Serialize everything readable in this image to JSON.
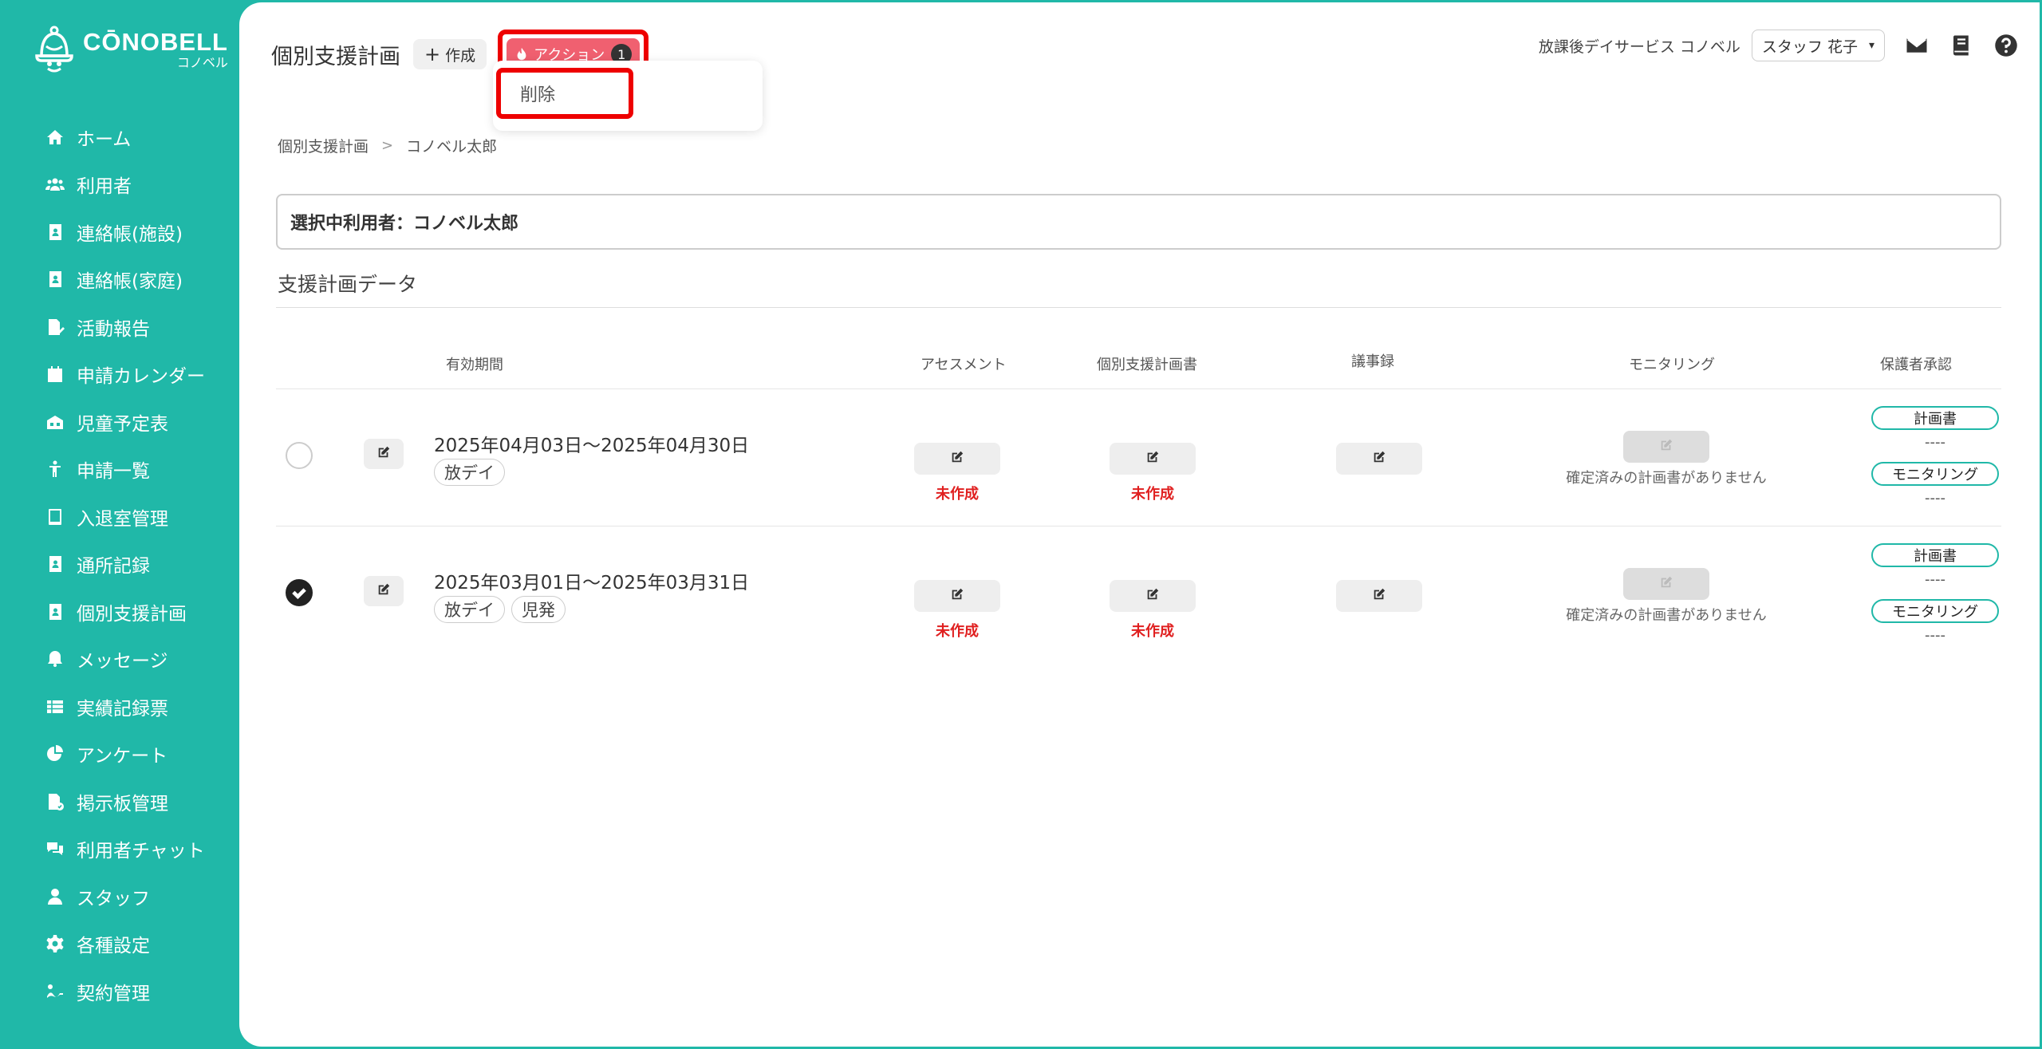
{
  "brand": {
    "name": "CŌNOBELL",
    "sub": "コノベル"
  },
  "sidebar": {
    "items": [
      {
        "label": "ホーム",
        "icon": "home-icon"
      },
      {
        "label": "利用者",
        "icon": "users-icon"
      },
      {
        "label": "連絡帳(施設)",
        "icon": "contact-book-icon"
      },
      {
        "label": "連絡帳(家庭)",
        "icon": "contact-book-icon"
      },
      {
        "label": "活動報告",
        "icon": "report-icon"
      },
      {
        "label": "申請カレンダー",
        "icon": "calendar-icon"
      },
      {
        "label": "児童予定表",
        "icon": "schedule-icon"
      },
      {
        "label": "申請一覧",
        "icon": "child-icon"
      },
      {
        "label": "入退室管理",
        "icon": "tablet-icon"
      },
      {
        "label": "通所記録",
        "icon": "record-icon"
      },
      {
        "label": "個別支援計画",
        "icon": "plan-icon"
      },
      {
        "label": "メッセージ",
        "icon": "bell-icon"
      },
      {
        "label": "実績記録票",
        "icon": "table-icon"
      },
      {
        "label": "アンケート",
        "icon": "pie-chart-icon"
      },
      {
        "label": "掲示板管理",
        "icon": "board-icon"
      },
      {
        "label": "利用者チャット",
        "icon": "chat-icon"
      },
      {
        "label": "スタッフ",
        "icon": "staff-icon"
      },
      {
        "label": "各種設定",
        "icon": "gear-icon"
      },
      {
        "label": "契約管理",
        "icon": "contract-icon"
      }
    ]
  },
  "header": {
    "title": "個別支援計画",
    "create_label": "作成",
    "action_label": "アクション",
    "action_badge": "1",
    "dropdown_item": "削除",
    "facility": "放課後デイサービス コノベル",
    "staff": "スタッフ 花子"
  },
  "breadcrumb": {
    "root": "個別支援計画",
    "current": "コノベル太郎"
  },
  "selected_user": "選択中利用者：コノベル太郎",
  "section_title": "支援計画データ",
  "table": {
    "headers": {
      "period": "有効期間",
      "assessment": "アセスメント",
      "plan": "個別支援計画書",
      "minutes": "議事録",
      "monitoring": "モニタリング",
      "approval": "保護者承認"
    },
    "rows": [
      {
        "checked": false,
        "period": "2025年04月03日～2025年04月30日",
        "tags": [
          "放デイ"
        ],
        "assessment_status": "未作成",
        "plan_status": "未作成",
        "monitoring_note": "確定済みの計画書がありません",
        "approval_plan_label": "計画書",
        "approval_plan_value": "----",
        "approval_monitoring_label": "モニタリング",
        "approval_monitoring_value": "----"
      },
      {
        "checked": true,
        "period": "2025年03月01日～2025年03月31日",
        "tags": [
          "放デイ",
          "児発"
        ],
        "assessment_status": "未作成",
        "plan_status": "未作成",
        "monitoring_note": "確定済みの計画書がありません",
        "approval_plan_label": "計画書",
        "approval_plan_value": "----",
        "approval_monitoring_label": "モニタリング",
        "approval_monitoring_value": "----"
      }
    ]
  },
  "colors": {
    "accent": "#20b8a8",
    "action": "#f06070",
    "highlight": "#e00000",
    "status_red": "#e02020"
  }
}
